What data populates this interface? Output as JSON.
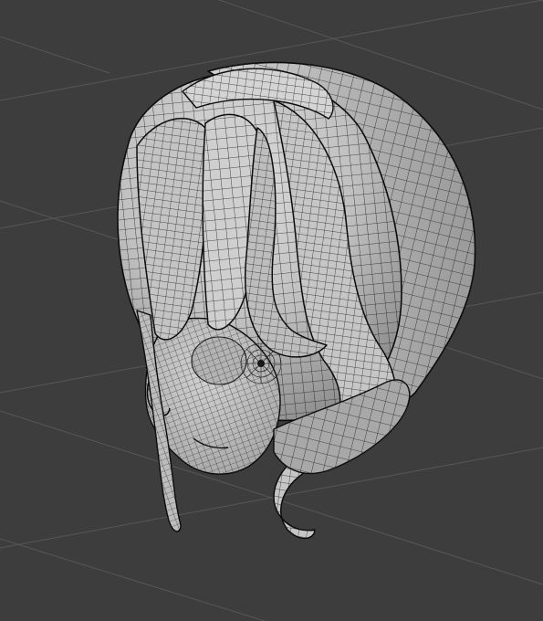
{
  "viewport": {
    "background_color": "#3d3d3d",
    "grid_color": "#575757",
    "mesh": {
      "fill_base": "#b9b9b9",
      "fill_light": "#d6d6d6",
      "fill_shadow": "#8f8f8f",
      "wire_color": "#1e1e1e",
      "outline_color": "#0c0c0c"
    }
  }
}
